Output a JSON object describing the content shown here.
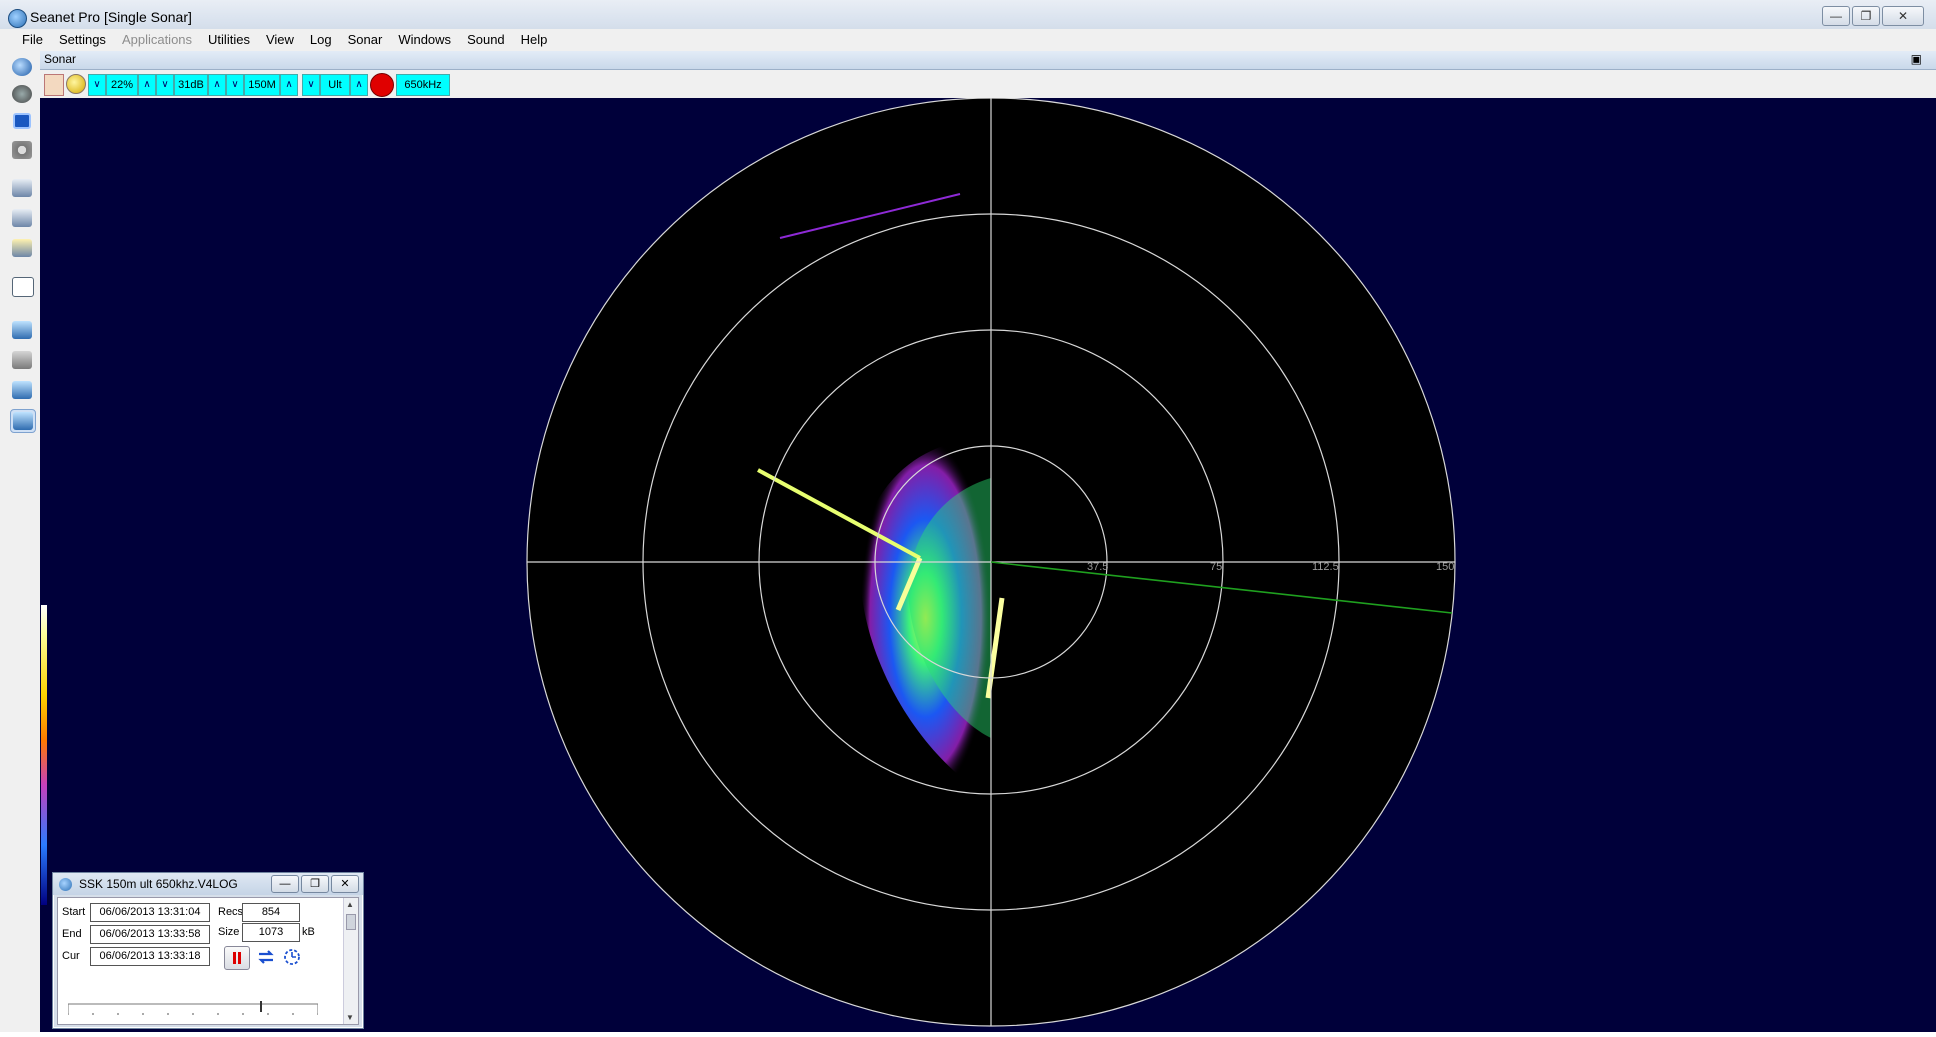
{
  "window": {
    "title": "Seanet Pro [Single Sonar]"
  },
  "menu": [
    "File",
    "Settings",
    "Applications",
    "Utilities",
    "View",
    "Log",
    "Sonar",
    "Windows",
    "Sound",
    "Help"
  ],
  "panel": {
    "title": "Sonar"
  },
  "sonar_toolbar": {
    "gain": "22%",
    "contrast": "31dB",
    "range": "150M",
    "mode": "Ult",
    "frequency": "650kHz"
  },
  "range_rings": {
    "labels": [
      "37.5",
      "75",
      "112.5",
      "150"
    ]
  },
  "log_window": {
    "title": "SSK 150m ult 650khz.V4LOG",
    "start_label": "Start",
    "start_value": "06/06/2013 13:31:04",
    "end_label": "End",
    "end_value": "06/06/2013 13:33:58",
    "cur_label": "Cur",
    "cur_value": "06/06/2013 13:33:18",
    "recs_label": "Recs",
    "recs_value": "854",
    "size_label": "Size",
    "size_value": "1073",
    "size_unit": "kB",
    "playback_position": 0.77
  },
  "colors": {
    "display_bg": "#00003a",
    "accent_cyan": "#00ffff",
    "record_red": "#e00000"
  },
  "icons": [
    "seanet-icon",
    "play-icon",
    "stop-icon",
    "settings-icon",
    "print-icon",
    "monitor-icon"
  ]
}
